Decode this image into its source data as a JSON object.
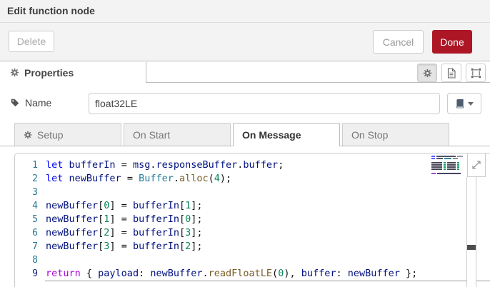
{
  "dialog": {
    "title": "Edit function node"
  },
  "toolbar": {
    "delete_label": "Delete",
    "cancel_label": "Cancel",
    "done_label": "Done"
  },
  "properties_bar": {
    "label": "Properties",
    "view_buttons": [
      {
        "icon": "gear-icon",
        "pressed": true
      },
      {
        "icon": "file-icon",
        "pressed": false
      },
      {
        "icon": "object-group-icon",
        "pressed": false
      }
    ]
  },
  "name_field": {
    "label": "Name",
    "value": "float32LE",
    "icon": "tag-icon",
    "library_button_icon": "book-icon"
  },
  "function_tabs": [
    {
      "label": "Setup",
      "active": false,
      "has_gear_icon": true
    },
    {
      "label": "On Start",
      "active": false,
      "has_gear_icon": false
    },
    {
      "label": "On Message",
      "active": true,
      "has_gear_icon": false
    },
    {
      "label": "On Stop",
      "active": false,
      "has_gear_icon": false
    }
  ],
  "colors": {
    "accent": "#AD1625",
    "keyword": "#0000FF",
    "control": "#AF00DB",
    "variable": "#001080",
    "type": "#267F99",
    "method": "#795E26",
    "number": "#098658",
    "line_number": "#237893"
  },
  "editor": {
    "expand_icon": "expand-diagonal-icon",
    "minimap_icon": "minimap",
    "lines": [
      {
        "num": 1,
        "active": false,
        "tokens": [
          [
            "kw",
            "let"
          ],
          [
            "pl",
            " "
          ],
          [
            "vr",
            "bufferIn"
          ],
          [
            "pl",
            " = "
          ],
          [
            "vr",
            "msg"
          ],
          [
            "pl",
            "."
          ],
          [
            "vr",
            "responseBuffer"
          ],
          [
            "pl",
            "."
          ],
          [
            "vr",
            "buffer"
          ],
          [
            "pl",
            ";"
          ]
        ]
      },
      {
        "num": 2,
        "active": false,
        "tokens": [
          [
            "kw",
            "let"
          ],
          [
            "pl",
            " "
          ],
          [
            "vr",
            "newBuffer"
          ],
          [
            "pl",
            " = "
          ],
          [
            "ty",
            "Buffer"
          ],
          [
            "pl",
            "."
          ],
          [
            "fn",
            "alloc"
          ],
          [
            "pl",
            "("
          ],
          [
            "nu",
            "4"
          ],
          [
            "pl",
            ");"
          ]
        ]
      },
      {
        "num": 3,
        "active": false,
        "tokens": []
      },
      {
        "num": 4,
        "active": false,
        "tokens": [
          [
            "vr",
            "newBuffer"
          ],
          [
            "pl",
            "["
          ],
          [
            "nu",
            "0"
          ],
          [
            "pl",
            "] = "
          ],
          [
            "vr",
            "bufferIn"
          ],
          [
            "pl",
            "["
          ],
          [
            "nu",
            "1"
          ],
          [
            "pl",
            "];"
          ]
        ]
      },
      {
        "num": 5,
        "active": false,
        "tokens": [
          [
            "vr",
            "newBuffer"
          ],
          [
            "pl",
            "["
          ],
          [
            "nu",
            "1"
          ],
          [
            "pl",
            "] = "
          ],
          [
            "vr",
            "bufferIn"
          ],
          [
            "pl",
            "["
          ],
          [
            "nu",
            "0"
          ],
          [
            "pl",
            "];"
          ]
        ]
      },
      {
        "num": 6,
        "active": false,
        "tokens": [
          [
            "vr",
            "newBuffer"
          ],
          [
            "pl",
            "["
          ],
          [
            "nu",
            "2"
          ],
          [
            "pl",
            "] = "
          ],
          [
            "vr",
            "bufferIn"
          ],
          [
            "pl",
            "["
          ],
          [
            "nu",
            "3"
          ],
          [
            "pl",
            "];"
          ]
        ]
      },
      {
        "num": 7,
        "active": false,
        "tokens": [
          [
            "vr",
            "newBuffer"
          ],
          [
            "pl",
            "["
          ],
          [
            "nu",
            "3"
          ],
          [
            "pl",
            "] = "
          ],
          [
            "vr",
            "bufferIn"
          ],
          [
            "pl",
            "["
          ],
          [
            "nu",
            "2"
          ],
          [
            "pl",
            "];"
          ]
        ]
      },
      {
        "num": 8,
        "active": false,
        "tokens": []
      },
      {
        "num": 9,
        "active": true,
        "tokens": [
          [
            "ct",
            "return"
          ],
          [
            "pl",
            " { "
          ],
          [
            "vr",
            "payload"
          ],
          [
            "pl",
            ": "
          ],
          [
            "vr",
            "newBuffer"
          ],
          [
            "pl",
            "."
          ],
          [
            "fn",
            "readFloatLE"
          ],
          [
            "pl",
            "("
          ],
          [
            "nu",
            "0"
          ],
          [
            "pl",
            "), "
          ],
          [
            "vr",
            "buffer"
          ],
          [
            "pl",
            ": "
          ],
          [
            "vr",
            "newBuffer"
          ],
          [
            "pl",
            " };"
          ]
        ]
      }
    ]
  }
}
